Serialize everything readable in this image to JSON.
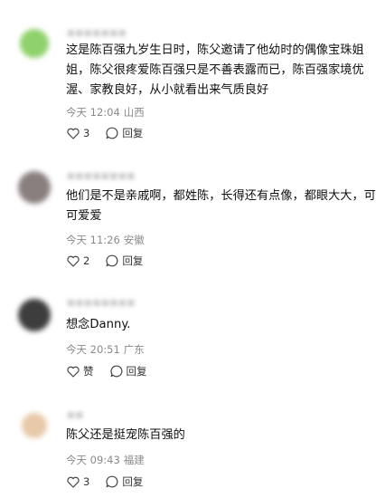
{
  "comments": [
    {
      "avatar_color": "#8fd16a",
      "username": "(blurred username)",
      "text": "这是陈百强九岁生日时，陈父邀请了他幼时的偶像宝珠姐姐，陈父很疼爱陈百强只是不善表露而已，陈百强家境优渥、家教良好，从小就看出来气质良好",
      "time": "今天 12:04",
      "location": "山西",
      "likes": "3",
      "reply_label": "回复"
    },
    {
      "avatar_color": "#8a7f7f",
      "username": "(blurred username)",
      "text": "他们是不是亲戚啊，都姓陈，长得还有点像，都眼大大，可可爱爱",
      "time": "今天 11:26",
      "location": "安徽",
      "likes": "2",
      "reply_label": "回复"
    },
    {
      "avatar_color": "#3d3d3d",
      "username": "(blurred username)",
      "text": "想念Danny.",
      "time": "今天 20:51",
      "location": "广东",
      "likes": "赞",
      "reply_label": "回复"
    },
    {
      "avatar_color": "#e8c9a8",
      "username": "(blurred username)",
      "text": "陈父还是挺宠陈百强的",
      "time": "今天 09:43",
      "location": "福建",
      "likes": "3",
      "reply_label": "回复"
    }
  ]
}
